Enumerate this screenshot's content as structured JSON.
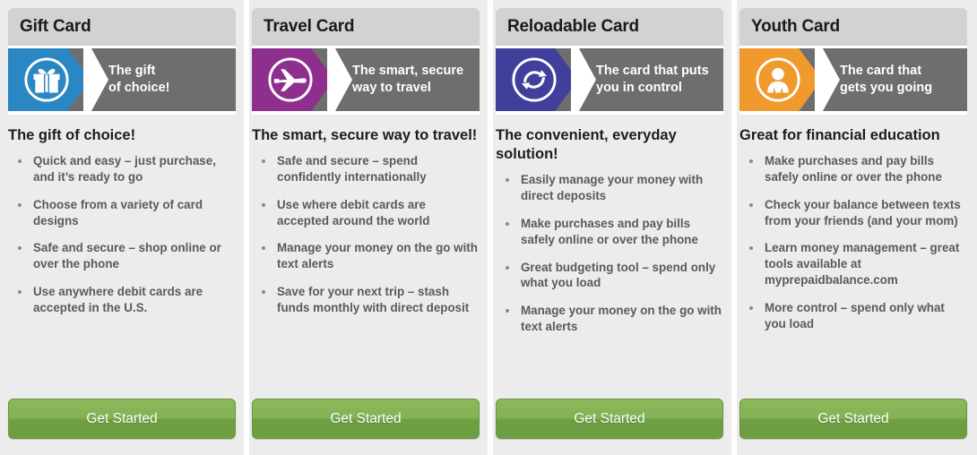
{
  "page": {
    "background_color": "#ececec",
    "band_color": "#6e6e6e"
  },
  "cards": [
    {
      "title": "Gift Card",
      "accent_color": "#2b87c3",
      "icon_name": "gift-box-icon",
      "tagline_line1": "The gift",
      "tagline_line2": "of choice!",
      "heading": "The gift of choice!",
      "features": [
        "Quick and easy – just purchase, and it’s ready to go",
        "Choose from a variety of card designs",
        "Safe and secure – shop online or over the phone",
        "Use anywhere debit cards are accepted in the U.S."
      ],
      "cta_label": "Get Started"
    },
    {
      "title": "Travel Card",
      "accent_color": "#8e2f8e",
      "icon_name": "airplane-icon",
      "tagline_line1": "The smart, secure",
      "tagline_line2": "way to travel",
      "heading": "The smart, secure way to travel!",
      "features": [
        "Safe and secure – spend confidently internationally",
        "Use where debit cards are accepted around the world",
        "Manage your money on the go with text alerts",
        "Save for your next trip – stash funds monthly with direct deposit"
      ],
      "cta_label": "Get Started"
    },
    {
      "title": "Reloadable Card",
      "accent_color": "#403f9b",
      "icon_name": "refresh-arrows-icon",
      "tagline_line1": "The card that puts",
      "tagline_line2": "you in control",
      "heading": "The convenient, everyday solution!",
      "features": [
        "Easily manage your money with direct deposits",
        "Make purchases and pay bills safely online or over the phone",
        "Great budgeting tool – spend only what you load",
        "Manage your money on the go with text alerts"
      ],
      "cta_label": "Get Started"
    },
    {
      "title": "Youth Card",
      "accent_color": "#f0992c",
      "icon_name": "child-person-icon",
      "tagline_line1": "The card that",
      "tagline_line2": "gets you going",
      "heading": "Great for financial education",
      "features": [
        "Make purchases and pay bills safely online or over the phone",
        "Check your balance between texts from your friends (and your mom)",
        "Learn money management – great tools available at myprepaidbalance.com",
        "More control – spend only what you load"
      ],
      "cta_label": "Get Started"
    }
  ]
}
